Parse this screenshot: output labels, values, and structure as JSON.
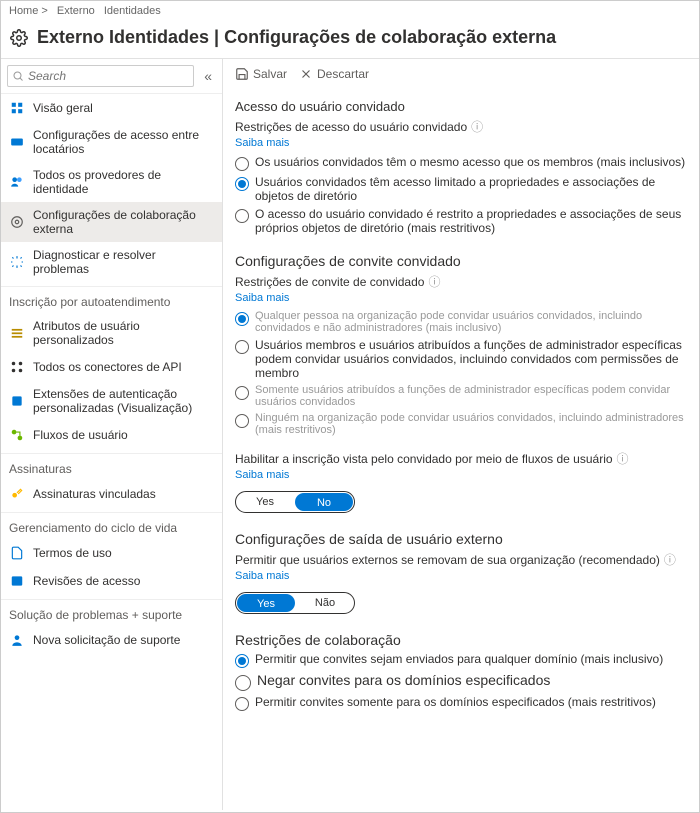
{
  "breadcrumb": {
    "home": "Home >",
    "seg1": "Externo",
    "seg2": "Identidades"
  },
  "header": {
    "title": "Externo  Identidades | Configurações de colaboração externa"
  },
  "search": {
    "placeholder": "Search"
  },
  "sidebar": {
    "items": [
      {
        "label": "Visão geral"
      },
      {
        "label": "Configurações de acesso entre locatários"
      },
      {
        "label": "Todos os provedores de identidade"
      },
      {
        "label": "Configurações de colaboração externa"
      },
      {
        "label": "Diagnosticar e resolver problemas"
      }
    ],
    "group_selfservice": "Inscrição por autoatendimento",
    "selfservice": [
      {
        "label": "Atributos de usuário personalizados"
      },
      {
        "label": "Todos os conectores de API"
      },
      {
        "label": "Extensões de autenticação personalizadas (Visualização)"
      },
      {
        "label": "Fluxos de usuário"
      }
    ],
    "group_subs": "Assinaturas",
    "subs": [
      {
        "label": "Assinaturas vinculadas"
      }
    ],
    "group_lifecycle": "Gerenciamento do ciclo de vida",
    "lifecycle": [
      {
        "label": "Termos de uso"
      },
      {
        "label": "Revisões de acesso"
      }
    ],
    "group_support": "Solução de problemas + suporte",
    "support": [
      {
        "label": "Nova solicitação de suporte"
      }
    ]
  },
  "toolbar": {
    "save": "Salvar",
    "discard": "Descartar"
  },
  "section1": {
    "title": "Acesso do usuário convidado",
    "sub": "Restrições de acesso do usuário convidado",
    "learn": "Saiba mais",
    "opt1": "Os usuários convidados têm o mesmo acesso que os membros (mais inclusivos)",
    "opt2": "Usuários convidados têm acesso limitado a propriedades e associações de objetos de diretório",
    "opt3": "O acesso do usuário convidado é restrito a propriedades e associações de seus próprios objetos de diretório (mais restritivos)"
  },
  "section2": {
    "title": "Configurações de convite convidado",
    "sub": "Restrições de convite de convidado",
    "learn": "Saiba mais",
    "opt1": "Qualquer pessoa na organização pode convidar usuários convidados, incluindo convidados e não administradores (mais inclusivo)",
    "opt2": "Usuários membros e usuários atribuídos a funções de administrador específicas podem convidar usuários convidados, incluindo convidados com permissões de membro",
    "opt3": "Somente usuários atribuídos a funções de administrador específicas podem convidar usuários convidados",
    "opt4": "Ninguém na organização pode convidar usuários convidados, incluindo administradores (mais restritivos)"
  },
  "section3": {
    "title": "Habilitar a inscrição vista pelo convidado por meio de fluxos de usuário",
    "learn": "Saiba mais",
    "yes": "Yes",
    "no": "No"
  },
  "section4": {
    "title": "Configurações de saída de usuário externo",
    "sub": "Permitir que usuários externos se removam de sua organização (recomendado)",
    "learn": "Saiba mais",
    "yes": "Yes",
    "no": "Não"
  },
  "section5": {
    "title": "Restrições de colaboração",
    "opt1": "Permitir que convites sejam enviados para qualquer domínio (mais inclusivo)",
    "opt2": "Negar convites para os domínios especificados",
    "opt3": "Permitir convites somente para os domínios especificados (mais restritivos)"
  }
}
